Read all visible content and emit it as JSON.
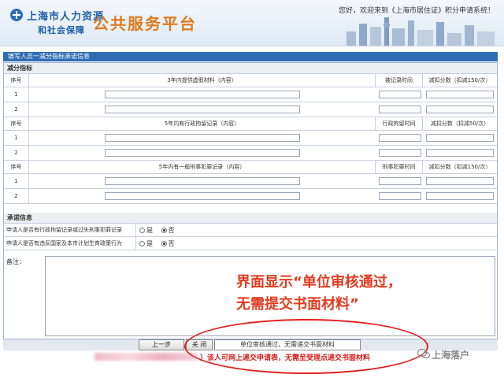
{
  "header": {
    "brand_line1": "上海市人力资源",
    "brand_line2": "和社会保障",
    "brand_title": "公共服务平台",
    "welcome": "您好，欢迎来到《上海市居住证》积分申请系统！"
  },
  "panel": {
    "title": "填写人员一减分指标承诺信息"
  },
  "deduction": {
    "section_label": "减分指标",
    "groups": [
      {
        "headers": [
          "序号",
          "3年内提供虚假材料（内容）",
          "被记录时间",
          "减扣分数（扣减150/次）"
        ],
        "rows": [
          "1",
          "2"
        ]
      },
      {
        "headers": [
          "序号",
          "5年内有行政拘留记录（内容）",
          "行政拘留时间",
          "减扣分数（扣减50/次）"
        ],
        "rows": [
          "1",
          "2"
        ]
      },
      {
        "headers": [
          "序号",
          "5年内有一般刑事犯罪记录（内容）",
          "刑事犯罪时间",
          "减扣分数（扣减150/次）"
        ],
        "rows": [
          "1",
          "2"
        ]
      }
    ]
  },
  "pledge": {
    "section_label": "承诺信息",
    "q1": "申请人是否有行政拘留记录或过失刑事犯罪记录",
    "q2": "申请人是否有违反国家及本市计划生育政策行为",
    "yes": "是",
    "no": "否"
  },
  "remark": {
    "label": "备注："
  },
  "annotation": {
    "line1": "界面显示“单位审核通过，",
    "line2": "无需提交书面材料”"
  },
  "buttons": {
    "prev": "上一步",
    "close": "关 闭"
  },
  "status_text": "单位审核通过，无需递交书面材料",
  "notice": "）该人可网上递交申请表，无需至受理点递交书面材料",
  "watermark": "上海落户",
  "colors": {
    "title_bar": "#2f6db3",
    "annotation_red": "#e23b1f",
    "brand_orange": "#e07a1f",
    "brand_blue": "#1d5ea8"
  }
}
